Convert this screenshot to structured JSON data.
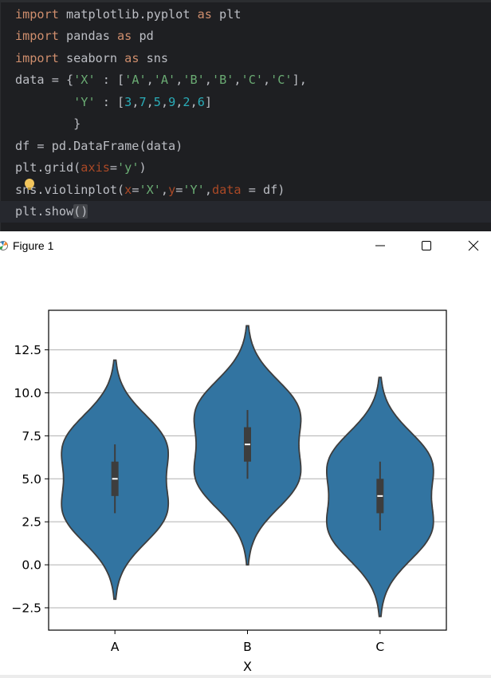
{
  "editor": {
    "lines": [
      {
        "id": "l1",
        "tokens": [
          [
            "kw",
            "import"
          ],
          [
            "",
            " matplotlib.pyplot "
          ],
          [
            "kw",
            "as"
          ],
          [
            "",
            " plt"
          ]
        ]
      },
      {
        "id": "l2",
        "tokens": [
          [
            "kw",
            "import"
          ],
          [
            "",
            " pandas "
          ],
          [
            "kw",
            "as"
          ],
          [
            "",
            " pd"
          ]
        ]
      },
      {
        "id": "l3",
        "tokens": [
          [
            "kw",
            "import"
          ],
          [
            "",
            " seaborn "
          ],
          [
            "kw",
            "as"
          ],
          [
            "",
            " sns"
          ]
        ]
      },
      {
        "id": "l4",
        "tokens": [
          [
            "",
            "data = {"
          ],
          [
            "str",
            "'X'"
          ],
          [
            "",
            " : ["
          ],
          [
            "str",
            "'A'"
          ],
          [
            "",
            ","
          ],
          [
            "str",
            "'A'"
          ],
          [
            "",
            ","
          ],
          [
            "str",
            "'B'"
          ],
          [
            "",
            ","
          ],
          [
            "str",
            "'B'"
          ],
          [
            "",
            ","
          ],
          [
            "str",
            "'C'"
          ],
          [
            "",
            ","
          ],
          [
            "str",
            "'C'"
          ],
          [
            "",
            "],"
          ]
        ]
      },
      {
        "id": "l5",
        "tokens": [
          [
            "",
            "        "
          ],
          [
            "str",
            "'Y'"
          ],
          [
            "",
            " : ["
          ],
          [
            "num",
            "3"
          ],
          [
            "",
            ","
          ],
          [
            "num",
            "7"
          ],
          [
            "",
            ","
          ],
          [
            "num",
            "5"
          ],
          [
            "",
            ","
          ],
          [
            "num",
            "9"
          ],
          [
            "",
            ","
          ],
          [
            "num",
            "2"
          ],
          [
            "",
            ","
          ],
          [
            "num",
            "6"
          ],
          [
            "",
            "]"
          ]
        ]
      },
      {
        "id": "l6",
        "tokens": [
          [
            "",
            "        }"
          ]
        ]
      },
      {
        "id": "l7",
        "tokens": [
          [
            "",
            "df = pd.DataFrame(data)"
          ]
        ]
      },
      {
        "id": "l8",
        "tokens": [
          [
            "",
            "plt.grid("
          ],
          [
            "par",
            "axis"
          ],
          [
            "",
            "="
          ],
          [
            "str",
            "'y'"
          ],
          [
            "",
            ")"
          ]
        ]
      },
      {
        "id": "l9",
        "tokens": [
          [
            "",
            "sns.violinplot("
          ],
          [
            "par",
            "x"
          ],
          [
            "",
            "="
          ],
          [
            "str",
            "'X'"
          ],
          [
            "",
            ","
          ],
          [
            "par",
            "y"
          ],
          [
            "",
            "="
          ],
          [
            "str",
            "'Y'"
          ],
          [
            "",
            ","
          ],
          [
            "par",
            "data"
          ],
          [
            "",
            " = df)"
          ]
        ]
      },
      {
        "id": "l10",
        "tokens": [
          [
            "",
            "plt.show"
          ],
          [
            "br",
            "()"
          ]
        ]
      }
    ],
    "colors": {
      "background": "#1e1f22",
      "keyword": "#cf8e6d",
      "string": "#6aab73",
      "number": "#2aacb8",
      "param": "#aa4926",
      "text": "#bcbec4"
    },
    "icons": {
      "intention": "lightbulb-icon"
    }
  },
  "window": {
    "title": "Figure 1",
    "icons": {
      "app": "matplotlib-figure-icon",
      "minimize": "minimize-icon",
      "maximize": "maximize-icon",
      "close": "close-icon"
    }
  },
  "chart_data": {
    "type": "violin",
    "title": "",
    "xlabel": "X",
    "ylabel": "",
    "categories": [
      "A",
      "B",
      "C"
    ],
    "raw_values": {
      "A": [
        3,
        7
      ],
      "B": [
        5,
        9
      ],
      "C": [
        2,
        6
      ]
    },
    "summary": [
      {
        "category": "A",
        "median": 5,
        "q1": 4,
        "q3": 6,
        "whisker_low": 3,
        "whisker_high": 7,
        "kde_min": -2,
        "kde_max": 11.9,
        "peak_y": 5
      },
      {
        "category": "B",
        "median": 7,
        "q1": 6,
        "q3": 8,
        "whisker_low": 5,
        "whisker_high": 9,
        "kde_min": 0,
        "kde_max": 13.9,
        "peak_y": 7
      },
      {
        "category": "C",
        "median": 4,
        "q1": 3,
        "q3": 5,
        "whisker_low": 2,
        "whisker_high": 6,
        "kde_min": -3,
        "kde_max": 10.9,
        "peak_y": 4
      }
    ],
    "yticks": [
      -2.5,
      0.0,
      2.5,
      5.0,
      7.5,
      10.0,
      12.5
    ],
    "ytick_labels": [
      "−2.5",
      "0.0",
      "2.5",
      "5.0",
      "7.5",
      "10.0",
      "12.5"
    ],
    "ylim": [
      -3.8,
      14.8
    ],
    "grid": "y",
    "colors": {
      "violin_fill": "#3274a1",
      "outline": "#3d3d3d",
      "grid": "#b0b0b0",
      "median": "#ffffff"
    }
  }
}
